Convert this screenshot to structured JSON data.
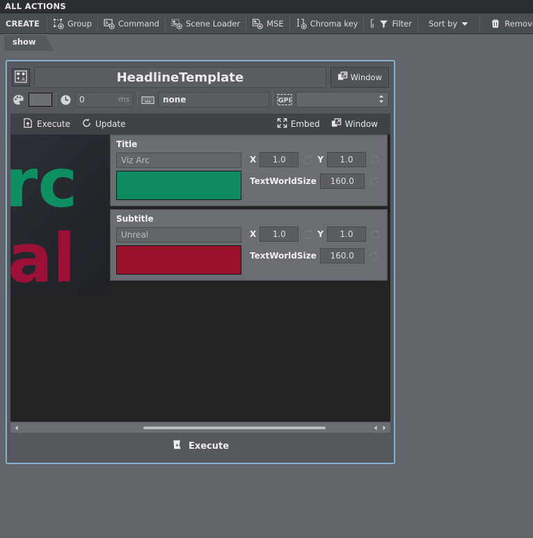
{
  "window": {
    "title": "ALL ACTIONS"
  },
  "toolbar": {
    "create_label": "CREATE",
    "items": [
      {
        "label": "Group",
        "icon": "group-add-icon"
      },
      {
        "label": "Command",
        "icon": "command-add-icon"
      },
      {
        "label": "Scene Loader",
        "icon": "scene-loader-add-icon"
      },
      {
        "label": "MSE",
        "icon": "mse-add-icon"
      },
      {
        "label": "Chroma key",
        "icon": "chroma-key-add-icon"
      },
      {
        "label": "Filter",
        "icon": "filter-icon"
      },
      {
        "label": "Sort by",
        "icon": "chevron-down-icon"
      },
      {
        "label": "Remove All",
        "icon": "trash-icon"
      }
    ]
  },
  "tabs": {
    "items": [
      {
        "label": "show",
        "active": true
      }
    ]
  },
  "panel": {
    "template_icon": "template-icon",
    "name": "HeadlineTemplate",
    "window_button": "Window",
    "properties": {
      "palette_icon": "palette-icon",
      "color_swatch": "#6c7075",
      "clock_icon": "clock-icon",
      "delay_value": "0",
      "delay_unit": "ms",
      "keyboard_icon": "keyboard-icon",
      "shortcut_value": "none",
      "gpi_icon": "gpi-icon",
      "gpi_value": "",
      "gpi_placeholder": ""
    },
    "actions": {
      "execute": "Execute",
      "update": "Update",
      "embed": "Embed",
      "window": "Window"
    },
    "preview": {
      "line1_text": "rc",
      "line1_color": "#0e8f62",
      "line2_text": "al",
      "line2_color": "#9c1038"
    },
    "groups": [
      {
        "title": "Title",
        "text_value": "Viz Arc",
        "color": "#0d8a5f",
        "x_label": "X",
        "x_value": "1.0",
        "y_label": "Y",
        "y_value": "1.0",
        "size_label": "TextWorldSize",
        "size_value": "160.0",
        "reset_icon": "reset-icon"
      },
      {
        "title": "Subtitle",
        "text_value": "Unreal",
        "color": "#99102a",
        "x_label": "X",
        "x_value": "1.0",
        "y_label": "Y",
        "y_value": "1.0",
        "size_label": "TextWorldSize",
        "size_value": "160.0",
        "reset_icon": "reset-icon"
      }
    ],
    "scrollbar": {
      "left_arrow_icon": "arrow-left-icon",
      "right_arrow_icon": "arrow-right-icon"
    },
    "footer": {
      "execute_label": "Execute",
      "execute_icon": "execute-icon"
    }
  },
  "colors": {
    "accent_border": "#82b4d6",
    "panel_bg": "#55595e",
    "app_bg": "#63676b",
    "canvas_bg": "#232323"
  }
}
